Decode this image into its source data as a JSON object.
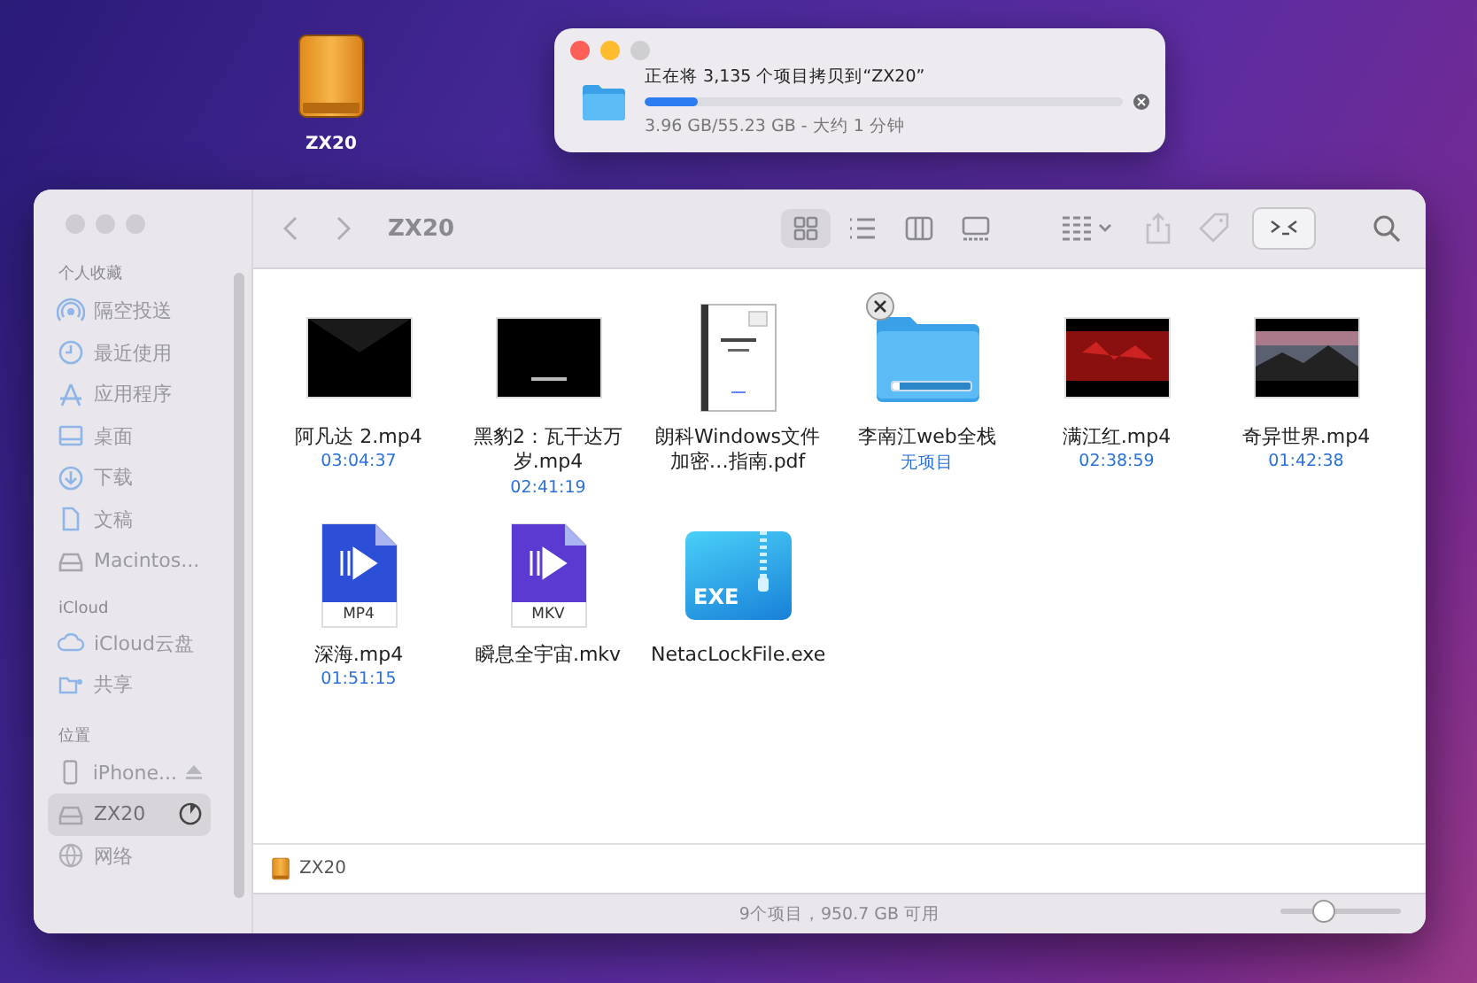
{
  "desktop": {
    "items": [
      {
        "label": "ZX20"
      }
    ]
  },
  "copy_dialog": {
    "message": "正在将 3,135 个项目拷贝到“ZX20”",
    "level": 0.11,
    "detail": "3.96 GB/55.23 GB - 大约 1 分钟"
  },
  "finder": {
    "title": "ZX20",
    "view_modes": [
      {
        "kind": "icons",
        "selected": true
      },
      {
        "kind": "list",
        "selected": false
      },
      {
        "kind": "columns",
        "selected": false
      },
      {
        "kind": "gallery",
        "selected": false
      }
    ],
    "sidebar": {
      "sections": [
        {
          "heading": "个人收藏",
          "items": [
            {
              "label": "隔空投送",
              "kind": "airdrop",
              "selected": false
            },
            {
              "label": "最近使用",
              "kind": "clock",
              "selected": false
            },
            {
              "label": "应用程序",
              "kind": "apps",
              "selected": false
            },
            {
              "label": "桌面",
              "kind": "desktop",
              "selected": false
            },
            {
              "label": "下载",
              "kind": "download",
              "selected": false
            },
            {
              "label": "文稿",
              "kind": "document",
              "selected": false
            },
            {
              "label": "Macintos...",
              "kind": "drive",
              "selected": false
            }
          ]
        },
        {
          "heading": "iCloud",
          "items": [
            {
              "label": "iCloud云盘",
              "kind": "cloud",
              "selected": false
            },
            {
              "label": "共享",
              "kind": "shared",
              "selected": false
            }
          ]
        },
        {
          "heading": "位置",
          "items": [
            {
              "label": "iPhone...",
              "kind": "phone",
              "selected": false,
              "ejectable": true
            },
            {
              "label": "ZX20",
              "kind": "drive",
              "selected": true,
              "level": 0.1
            },
            {
              "label": "网络",
              "kind": "globe",
              "selected": false
            }
          ]
        }
      ]
    },
    "files": [
      {
        "name": "阿凡达 2.mp4",
        "detail": "03:04:37",
        "kind": "video-black"
      },
      {
        "name": "黑豹2：瓦干达万岁.mp4",
        "detail": "02:41:19",
        "kind": "video-caption"
      },
      {
        "name": "朗科Windows文件加密…指南.pdf",
        "kind": "document"
      },
      {
        "name": "李南江web全栈",
        "detail": "无项目",
        "kind": "folder",
        "copying": true,
        "level": 0.1
      },
      {
        "name": "满江红.mp4",
        "detail": "02:38:59",
        "kind": "video-red"
      },
      {
        "name": "奇异世界.mp4",
        "detail": "01:42:38",
        "kind": "video-scene"
      },
      {
        "name": "深海.mp4",
        "detail": "01:51:15",
        "kind": "media-file",
        "badge": "MP4"
      },
      {
        "name": "瞬息全宇宙.mkv",
        "kind": "media-file",
        "badge": "MKV"
      },
      {
        "name": "NetacLockFile.exe",
        "kind": "app-file",
        "badge": "EXE"
      }
    ],
    "path_bar": [
      {
        "label": "ZX20"
      }
    ],
    "status_bar": "9个项目，950.7 GB 可用",
    "zoom_slider": {
      "level": 0.3
    }
  }
}
